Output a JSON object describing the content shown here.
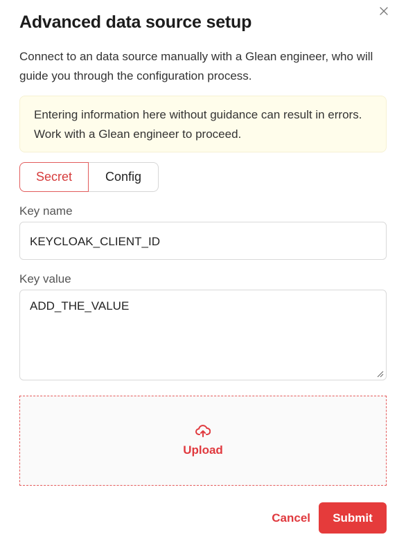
{
  "dialog": {
    "title": "Advanced data source setup",
    "description": "Connect to an data source manually with a Glean engineer, who will guide you through the configuration process.",
    "close_icon": "close-icon"
  },
  "warning": {
    "text": "Entering information here without guidance can result in errors. Work with a Glean engineer to proceed."
  },
  "tabs": [
    {
      "label": "Secret",
      "active": true
    },
    {
      "label": "Config",
      "active": false
    }
  ],
  "key_name": {
    "label": "Key name",
    "value": "KEYCLOAK_CLIENT_ID"
  },
  "key_value": {
    "label": "Key value",
    "value": "ADD_THE_VALUE"
  },
  "upload": {
    "icon": "cloud-upload-icon",
    "label": "Upload"
  },
  "footer": {
    "cancel_label": "Cancel",
    "submit_label": "Submit"
  },
  "colors": {
    "accent": "#e53b3b",
    "warning_bg": "#fffdeb"
  }
}
